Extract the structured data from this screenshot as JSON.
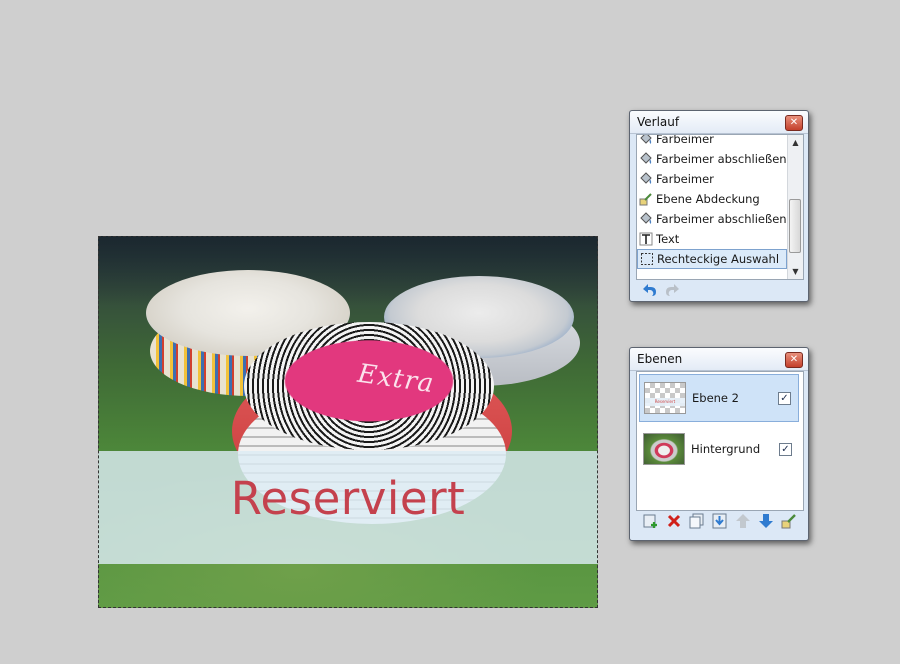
{
  "canvas": {
    "plate_text": "Extra",
    "overlay_text": "Reserviert"
  },
  "history": {
    "title": "Verlauf",
    "items": [
      {
        "label": "Farbeimer",
        "icon": "paint-bucket-icon"
      },
      {
        "label": "Farbeimer abschließen",
        "icon": "paint-bucket-icon"
      },
      {
        "label": "Farbeimer",
        "icon": "paint-bucket-icon"
      },
      {
        "label": "Ebene Abdeckung",
        "icon": "layer-opacity-icon"
      },
      {
        "label": "Farbeimer abschließen",
        "icon": "paint-bucket-icon"
      },
      {
        "label": "Text",
        "icon": "text-tool-icon"
      },
      {
        "label": "Rechteckige Auswahl",
        "icon": "rectangle-select-icon"
      }
    ],
    "selected_index": 6,
    "tools": [
      "undo-icon",
      "redo-icon"
    ]
  },
  "layers": {
    "title": "Ebenen",
    "items": [
      {
        "name": "Ebene 2",
        "visible": true,
        "selected": true,
        "thumb_text": "Reserviert"
      },
      {
        "name": "Hintergrund",
        "visible": true,
        "selected": false
      }
    ],
    "tools": [
      "add-layer-icon",
      "delete-layer-icon",
      "duplicate-layer-icon",
      "merge-down-icon",
      "move-up-icon",
      "move-down-icon",
      "layer-properties-icon"
    ]
  },
  "colors": {
    "workspace_bg": "#cfcfcf",
    "overlay_text": "#c4414d",
    "window_bg": "#dce8f6"
  }
}
